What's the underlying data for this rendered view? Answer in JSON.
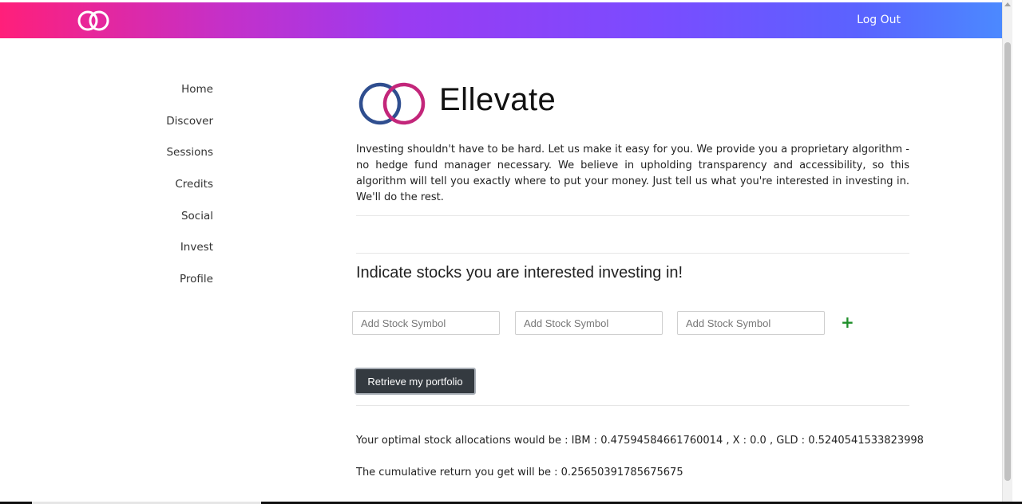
{
  "header": {
    "logout_label": "Log Out",
    "gradient_colors": [
      "#ff1f7a",
      "#9a3bf2",
      "#4a8cff"
    ],
    "brand_icon": "interlocking-rings-icon"
  },
  "sidebar": {
    "items": [
      {
        "label": "Home"
      },
      {
        "label": "Discover"
      },
      {
        "label": "Sessions"
      },
      {
        "label": "Credits"
      },
      {
        "label": "Social"
      },
      {
        "label": "Invest"
      },
      {
        "label": "Profile"
      }
    ]
  },
  "main": {
    "logo_text": "Ellevate",
    "logo_colors": [
      "#2f4e8f",
      "#c3267a"
    ],
    "intro": "Investing shouldn't have to be hard. Let us make it easy for you. We provide you a proprietary algorithm - no hedge fund manager necessary. We believe in upholding transparency and accessibility, so this algorithm will tell you exactly where to put your money. Just tell us what you're interested in investing in. We'll do the rest.",
    "heading": "Indicate stocks you are interested investing in!",
    "inputs": [
      {
        "placeholder": "Add Stock Symbol",
        "value": ""
      },
      {
        "placeholder": "Add Stock Symbol",
        "value": ""
      },
      {
        "placeholder": "Add Stock Symbol",
        "value": ""
      }
    ],
    "add_label": "+",
    "add_color": "#1f8f2a",
    "retrieve_label": "Retrieve my portfolio",
    "results": {
      "allocations": "Your optimal stock allocations would be : IBM : 0.47594584661760014 , X : 0.0 , GLD : 0.5240541533823998",
      "cumulative": "The cumulative return you get will be : 0.25650391785675675"
    }
  }
}
